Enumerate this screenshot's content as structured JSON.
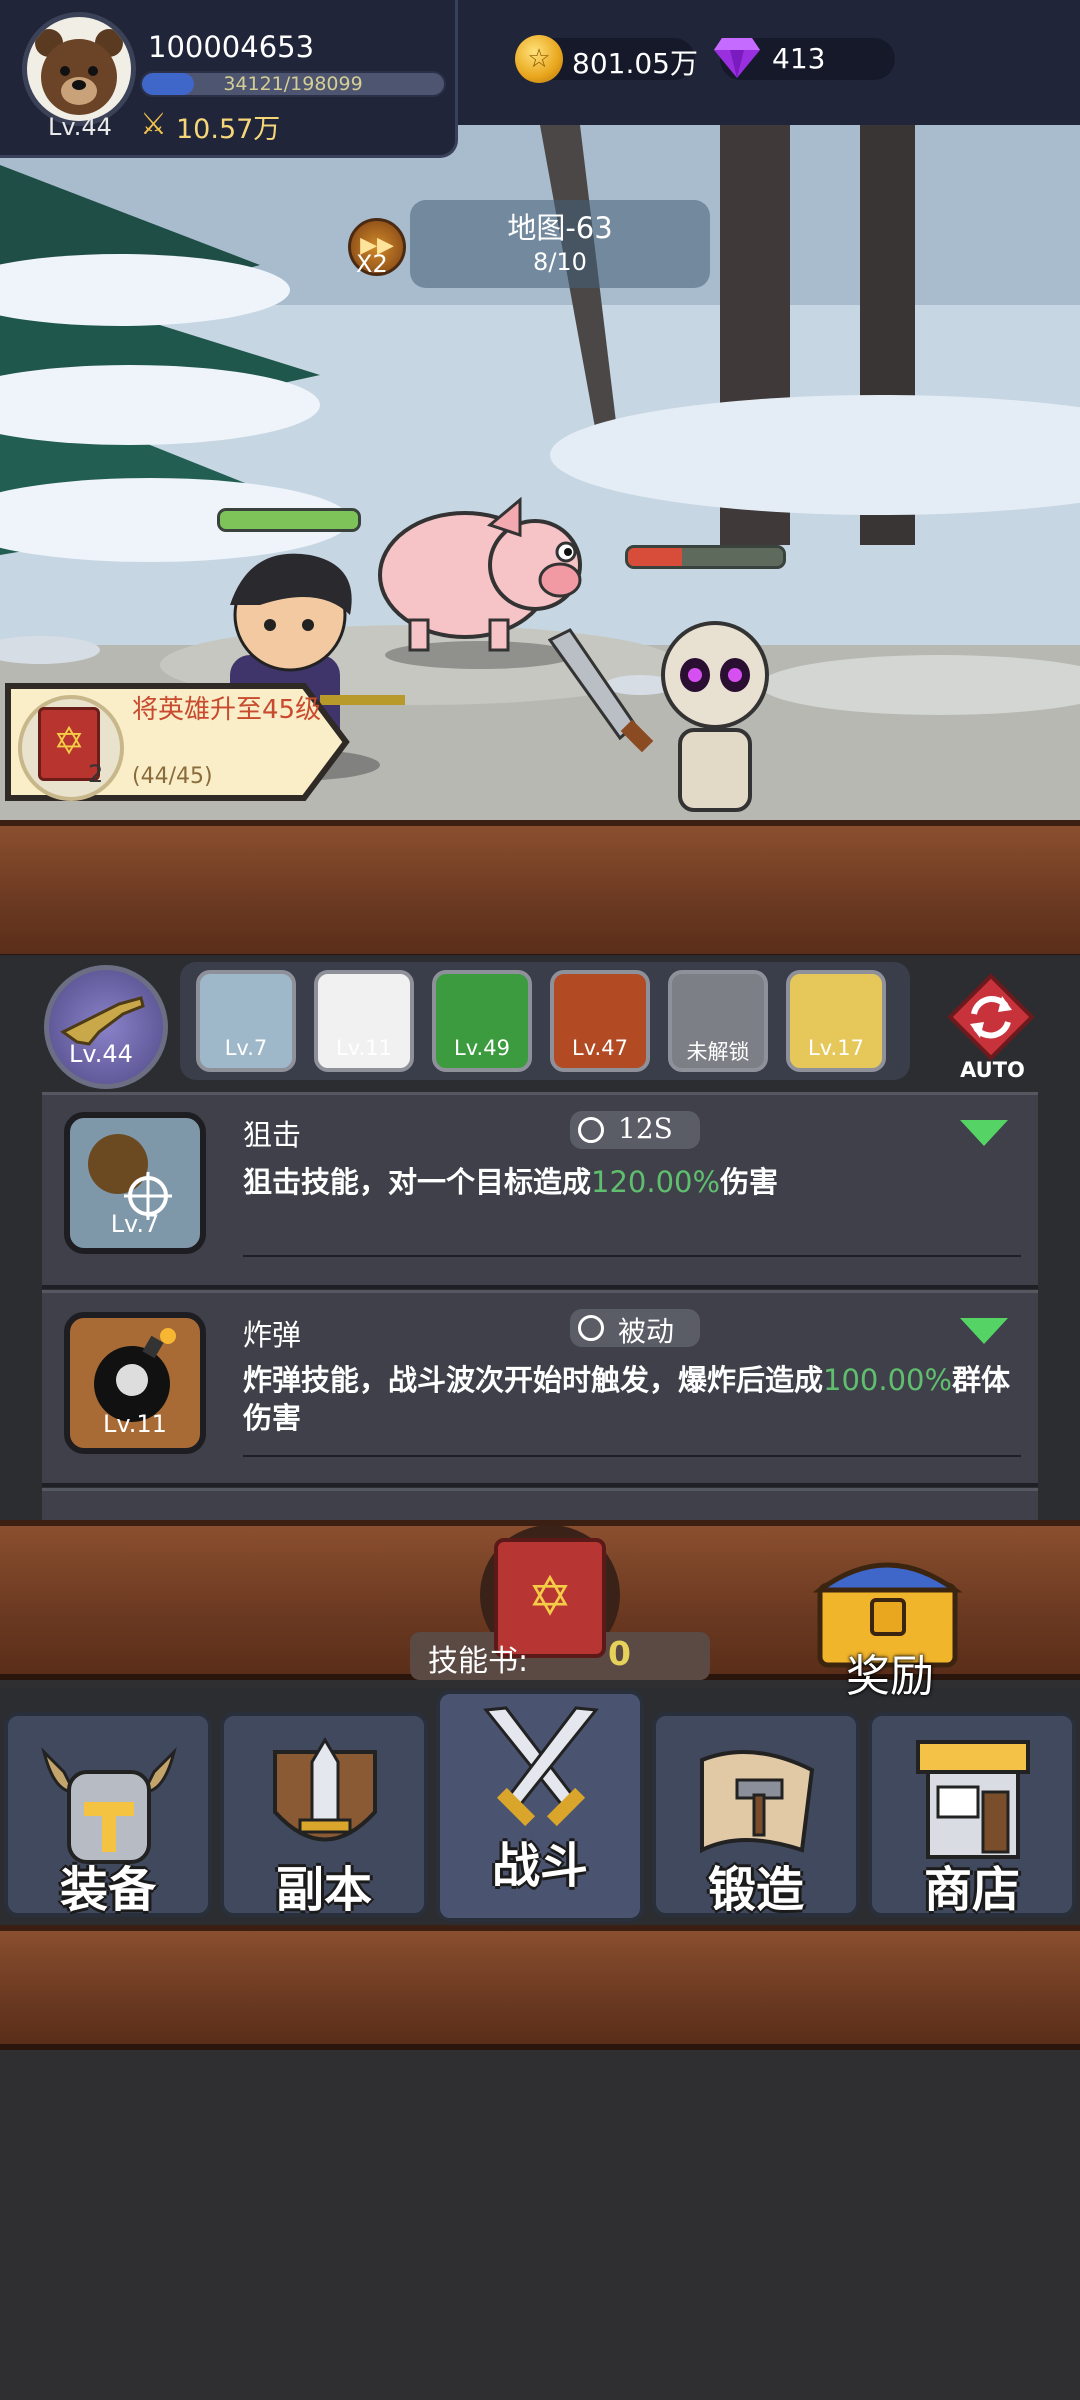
{
  "player": {
    "id": "100004653",
    "level": "Lv.44",
    "xp_text": "34121/198099",
    "xp_fraction": 0.172,
    "power": "10.57万"
  },
  "currency": {
    "coins": "801.05万",
    "gems": "413"
  },
  "battle": {
    "map_name": "地图-63",
    "wave": "8/10",
    "speed": "X2",
    "hero_hp_fraction": 1.0,
    "enemy_hp_fraction": 0.35
  },
  "quest": {
    "title": "将英雄升至45级",
    "progress": "(44/45)",
    "count": "2"
  },
  "weapon": {
    "level": "Lv.44"
  },
  "skill_slots": [
    {
      "level": "Lv.7",
      "color": "#9fb8c9"
    },
    {
      "level": "Lv.11",
      "color": "#f1f1f1"
    },
    {
      "level": "Lv.49",
      "color": "#3c9b3f"
    },
    {
      "level": "Lv.47",
      "color": "#b24b24"
    },
    {
      "level": "未解锁",
      "color": "#7d7f86"
    },
    {
      "level": "Lv.17",
      "color": "#e5c75a"
    }
  ],
  "auto_label": "AUTO",
  "skills": [
    {
      "name": "狙击",
      "cooldown": "12S",
      "desc_pre": "狙击技能，对一个目标造成",
      "desc_value": "120.00%",
      "desc_post": "伤害",
      "icon_level": "Lv.7"
    },
    {
      "name": "炸弹",
      "cooldown": "被动",
      "desc_pre": "炸弹技能，战斗波次开始时触发，爆炸后造成",
      "desc_value": "100.00%",
      "desc_post": "群体伤害",
      "icon_level": "Lv.11"
    }
  ],
  "skill_book": {
    "label": "技能书:",
    "value": "0"
  },
  "reward_label": "奖励",
  "nav": {
    "equipment": "装备",
    "dungeon": "副本",
    "battle": "战斗",
    "forge": "锻造",
    "shop": "商店"
  }
}
